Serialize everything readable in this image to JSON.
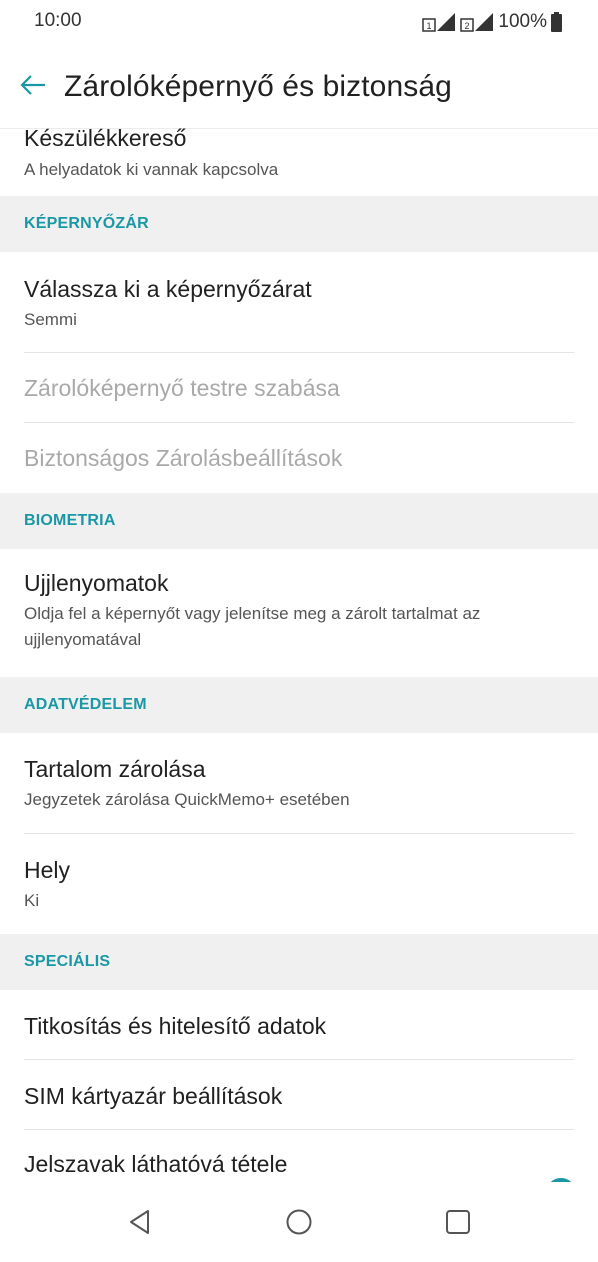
{
  "status_bar": {
    "time": "10:00",
    "battery": "100%",
    "icons": [
      "sim1-signal-icon",
      "sim2-signal-icon",
      "battery-icon"
    ]
  },
  "app_bar": {
    "title": "Zárolóképernyő és biztonság",
    "back_icon": "arrow-left-icon"
  },
  "items": {
    "device_finder": {
      "title": "Készülékkereső",
      "summary": "A helyadatok ki vannak kapcsolva"
    },
    "screen_lock_header": "KÉPERNYŐZÁR",
    "select_screen_lock": {
      "title": "Válassza ki a képernyőzárat",
      "summary": "Semmi"
    },
    "customize_lock_screen": {
      "title": "Zárolóképernyő testre szabása"
    },
    "secure_lock_settings": {
      "title": "Biztonságos Zárolásbeállítások"
    },
    "biometrics_header": "BIOMETRIA",
    "fingerprints": {
      "title": "Ujjlenyomatok",
      "summary": "Oldja fel a képernyőt vagy jelenítse meg a zárolt tartalmat az ujjlenyomatával"
    },
    "privacy_header": "ADATVÉDELEM",
    "content_lock": {
      "title": "Tartalom zárolása",
      "summary": "Jegyzetek zárolása QuickMemo+ esetében"
    },
    "location": {
      "title": "Hely",
      "summary": "Ki"
    },
    "special_header": "SPECIÁLIS",
    "encryption": {
      "title": "Titkosítás és hitelesítő adatok"
    },
    "sim_lock": {
      "title": "SIM kártyazár beállítások"
    },
    "show_passwords": {
      "title": "Jelszavak láthatóvá tétele",
      "toggle_on": true
    }
  },
  "nav_bar": {
    "icons": [
      "back-triangle-icon",
      "home-circle-icon",
      "recents-square-icon"
    ]
  },
  "colors": {
    "accent": "#1a98a6",
    "header_bg": "#f0f0f0",
    "disabled_text": "#a9a9a9"
  }
}
